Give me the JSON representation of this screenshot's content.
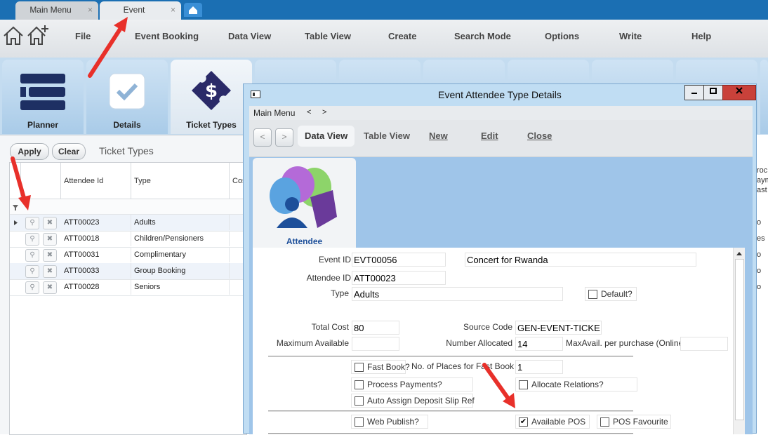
{
  "tabs": [
    {
      "label": "Main Menu"
    },
    {
      "label": "Event"
    }
  ],
  "tab_close_glyph": "×",
  "menu": {
    "file": "File",
    "event_booking": "Event Booking",
    "data_view": "Data View",
    "table_view": "Table View",
    "create": "Create",
    "search_mode": "Search Mode",
    "options": "Options",
    "write": "Write",
    "help": "Help"
  },
  "ribbon": {
    "planner": "Planner",
    "details": "Details",
    "ticket_types": "Ticket Types"
  },
  "grid_toolbar": {
    "apply": "Apply",
    "clear": "Clear",
    "title": "Ticket Types"
  },
  "grid": {
    "columns": {
      "attendee_id": "Attendee Id",
      "type": "Type",
      "cost": "Cos"
    },
    "rows": [
      {
        "id": "ATT00023",
        "type": "Adults"
      },
      {
        "id": "ATT00018",
        "type": "Children/Pensioners"
      },
      {
        "id": "ATT00031",
        "type": "Complimentary"
      },
      {
        "id": "ATT00033",
        "type": "Group Booking"
      },
      {
        "id": "ATT00028",
        "type": "Seniors"
      }
    ]
  },
  "dialog": {
    "title": "Event Attendee Type Details",
    "nav": {
      "main_menu": "Main Menu",
      "back": "<",
      "forward": ">"
    },
    "toolbar": {
      "data_view": "Data View",
      "table_view": "Table View",
      "new": "New",
      "edit": "Edit",
      "close": "Close"
    },
    "card_label": "Attendee",
    "fields": {
      "event_id": {
        "label": "Event ID",
        "value": "EVT00056"
      },
      "event_name": {
        "value": "Concert for Rwanda"
      },
      "attendee_id": {
        "label": "Attendee ID",
        "value": "ATT00023"
      },
      "type": {
        "label": "Type",
        "value": "Adults"
      },
      "default": {
        "label": "Default?",
        "checked": false
      },
      "total_cost": {
        "label": "Total Cost",
        "value": "80"
      },
      "source_code": {
        "label": "Source Code",
        "value": "GEN-EVENT-TICKE"
      },
      "max_available": {
        "label": "Maximum Available",
        "value": ""
      },
      "number_allocated": {
        "label": "Number Allocated",
        "value": "14"
      },
      "max_per_purchase": {
        "label": "MaxAvail. per purchase (Online)",
        "value": ""
      },
      "fast_book": {
        "label": "Fast Book?",
        "checked": false
      },
      "fast_book_places": {
        "label": "No. of Places for Fast Book",
        "value": "1"
      },
      "process_payments": {
        "label": "Process Payments?",
        "checked": false
      },
      "allocate_relations": {
        "label": "Allocate Relations?",
        "checked": false
      },
      "auto_assign": {
        "label": "Auto Assign Deposit Slip Ref",
        "checked": false
      },
      "web_publish": {
        "label": "Web Publish?",
        "checked": false
      },
      "available_pos": {
        "label": "Available POS",
        "checked": true
      },
      "pos_favourite": {
        "label": "POS Favourite",
        "checked": false
      }
    }
  },
  "right_edge_cells": [
    "roc",
    "aym",
    "ast",
    "o",
    "es",
    "o",
    "o",
    "o"
  ],
  "colors": {
    "tab_strip": "#1b6fb3",
    "ribbon": "#c4dcf0",
    "dialog_bg": "#9fc5e9",
    "arrow": "#e8302a"
  },
  "check_mark": "✔"
}
